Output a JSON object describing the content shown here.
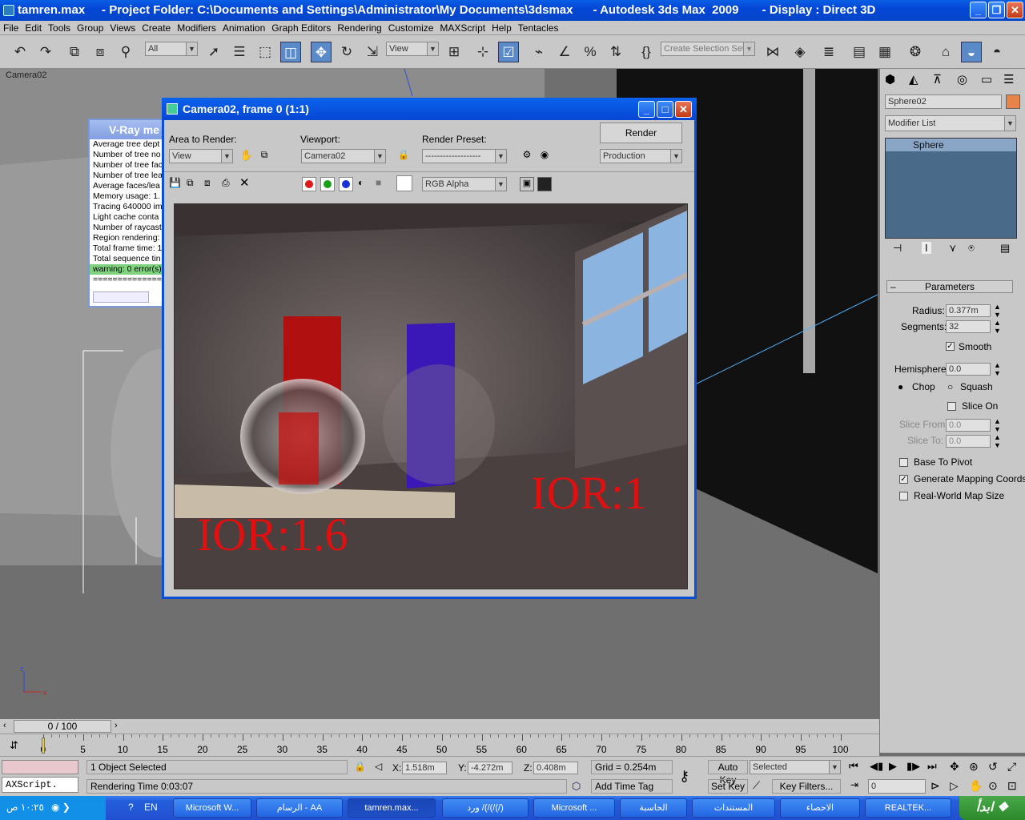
{
  "window": {
    "title": "tamren.max     - Project Folder: C:\\Documents and Settings\\Administrator\\My Documents\\3dsmax      - Autodesk 3ds Max  2009       - Display : Direct 3D"
  },
  "menu": [
    "File",
    "Edit",
    "Tools",
    "Group",
    "Views",
    "Create",
    "Modifiers",
    "Animation",
    "Graph Editors",
    "Rendering",
    "Customize",
    "MAXScript",
    "Help",
    "Tentacles"
  ],
  "toolbar": {
    "filter": "All",
    "refcoord": "View",
    "selection_set_placeholder": "Create Selection Set"
  },
  "viewport": {
    "label": "Camera02"
  },
  "vray_window": {
    "title": "V-Ray me",
    "lines": [
      "Average tree dept",
      "Number of tree no",
      "Number of tree fac",
      "Number of tree lea",
      "Average faces/lea",
      "Memory usage: 1.",
      "Tracing 640000 im",
      "Light cache conta",
      "Number of raycast",
      "Region rendering:",
      "Total frame time: 1",
      "Total sequence tin",
      "warning: 0 error(s)",
      "=================="
    ]
  },
  "render_window": {
    "title": "Camera02, frame 0 (1:1)",
    "area_label": "Area to Render:",
    "area_value": "View",
    "viewport_label": "Viewport:",
    "viewport_value": "Camera02",
    "preset_label": "Render Preset:",
    "preset_value": "-------------------",
    "render_button": "Render",
    "production_value": "Production",
    "channel_value": "RGB Alpha",
    "ior1": "IOR:1.6",
    "ior2": "IOR:1"
  },
  "right_panel": {
    "object_name": "Sphere02",
    "object_color": "#e8844a",
    "modifier_list": "Modifier List",
    "stack_item": "Sphere",
    "rollout_title": "Parameters",
    "radius_label": "Radius:",
    "radius_value": "0.377m",
    "segments_label": "Segments:",
    "segments_value": "32",
    "smooth_label": "Smooth",
    "hemisphere_label": "Hemisphere:",
    "hemisphere_value": "0.0",
    "chop_label": "Chop",
    "squash_label": "Squash",
    "slice_on_label": "Slice On",
    "slice_from_label": "Slice From:",
    "slice_from_value": "0.0",
    "slice_to_label": "Slice To:",
    "slice_to_value": "0.0",
    "base_to_pivot_label": "Base To Pivot",
    "gen_mapping_label": "Generate Mapping Coords.",
    "real_world_label": "Real-World Map Size"
  },
  "timeline": {
    "frame_label": "0 / 100",
    "ticks": [
      "0",
      "5",
      "10",
      "15",
      "20",
      "25",
      "30",
      "35",
      "40",
      "45",
      "50",
      "55",
      "60",
      "65",
      "70",
      "75",
      "80",
      "85",
      "90",
      "95",
      "100"
    ]
  },
  "status": {
    "selection": "1 Object Selected",
    "render_time": "Rendering Time  0:03:07",
    "maxscript": "AXScript.",
    "x_label": "X:",
    "x_value": "1.518m",
    "y_label": "Y:",
    "y_value": "-4.272m",
    "z_label": "Z:",
    "z_value": "0.408m",
    "grid": "Grid = 0.254m",
    "add_time_tag": "Add Time Tag",
    "auto_key": "Auto Key",
    "set_key": "Set Key",
    "selected": "Selected",
    "key_filters": "Key Filters...",
    "frame_field": "0"
  },
  "taskbar": {
    "start": "ابدأ",
    "clock": "١٠:٢٥ ص",
    "lang": "EN",
    "tasks": [
      "REALTEK...",
      "الاحصاء",
      "المستندات",
      "الحاسبة",
      "Microsoft ...",
      "ورد /(/(/(/)",
      "tamren.max...",
      "الرسام - AA",
      "Microsoft W..."
    ]
  }
}
